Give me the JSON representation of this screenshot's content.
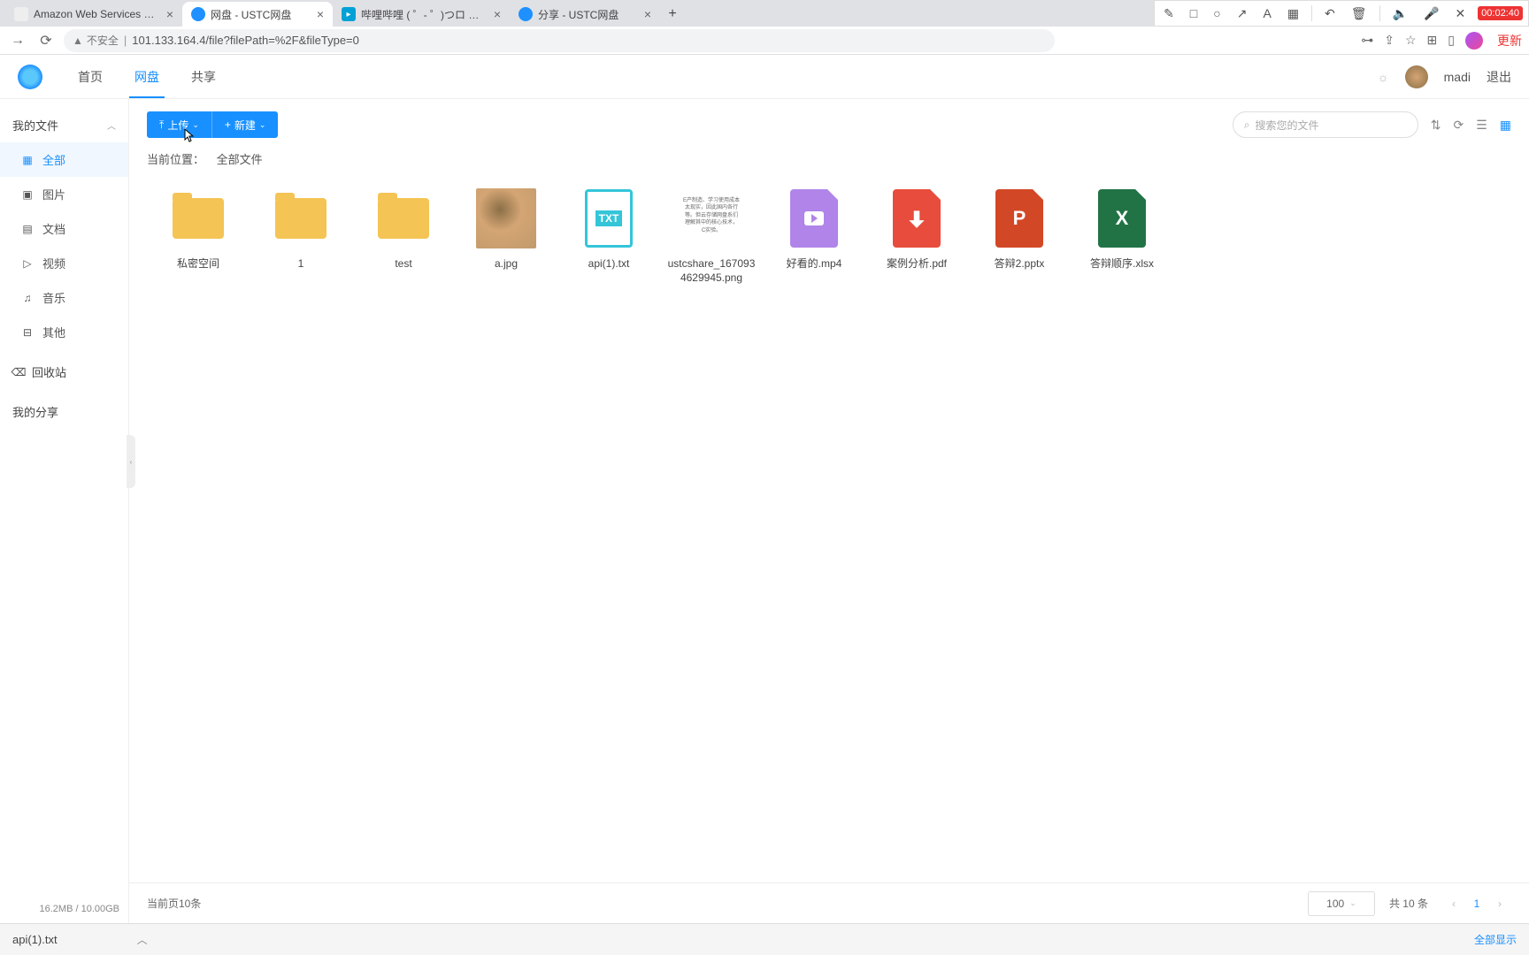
{
  "browser": {
    "tabs": [
      {
        "title": "Amazon Web Services Sign-In",
        "favColor": "#999"
      },
      {
        "title": "网盘 - USTC网盘",
        "favColor": "#1e90ff",
        "active": true
      },
      {
        "title": "哔哩哔哩 (  ゜- ゜)つロ 干杯~-bili…",
        "favColor": "#00a1d6"
      },
      {
        "title": "分享 - USTC网盘",
        "favColor": "#1e90ff"
      }
    ],
    "insecure_label": "不安全",
    "url": "101.133.164.4/file?filePath=%2F&fileType=0",
    "rec_time": "00:02:40",
    "update_label": "更新"
  },
  "header": {
    "nav": [
      {
        "label": "首页"
      },
      {
        "label": "网盘",
        "active": true
      },
      {
        "label": "共享"
      }
    ],
    "username": "madi",
    "logout": "退出"
  },
  "sidebar": {
    "myfiles": "我的文件",
    "items": [
      {
        "label": "全部",
        "icon": "grid",
        "active": true
      },
      {
        "label": "图片",
        "icon": "image"
      },
      {
        "label": "文档",
        "icon": "doc"
      },
      {
        "label": "视频",
        "icon": "video"
      },
      {
        "label": "音乐",
        "icon": "music"
      },
      {
        "label": "其他",
        "icon": "other"
      }
    ],
    "recycle": "回收站",
    "myshare": "我的分享",
    "storage": "16.2MB / 10.00GB"
  },
  "toolbar": {
    "upload": "上传",
    "create": "新建",
    "search_placeholder": "搜索您的文件"
  },
  "breadcrumb": {
    "label": "当前位置：",
    "path": "全部文件"
  },
  "files": [
    {
      "name": "私密空间",
      "type": "folder"
    },
    {
      "name": "1",
      "type": "folder"
    },
    {
      "name": "test",
      "type": "folder"
    },
    {
      "name": "a.jpg",
      "type": "image"
    },
    {
      "name": "api(1).txt",
      "type": "txt"
    },
    {
      "name": "ustcshare_1670934629945.png",
      "type": "png"
    },
    {
      "name": "好看的.mp4",
      "type": "video"
    },
    {
      "name": "案例分析.pdf",
      "type": "pdf"
    },
    {
      "name": "答辩2.pptx",
      "type": "ppt"
    },
    {
      "name": "答辩顺序.xlsx",
      "type": "xls"
    }
  ],
  "png_preview_text": "E产制造、学习使用成本太现实，因此国内各行等。但云存储网盘系们理解其中的核心技术，C实验。",
  "pagination": {
    "summary": "当前页10条",
    "pagesize": "100",
    "total": "共 10 条",
    "current": "1"
  },
  "download": {
    "file": "api(1).txt",
    "showall": "全部显示"
  }
}
